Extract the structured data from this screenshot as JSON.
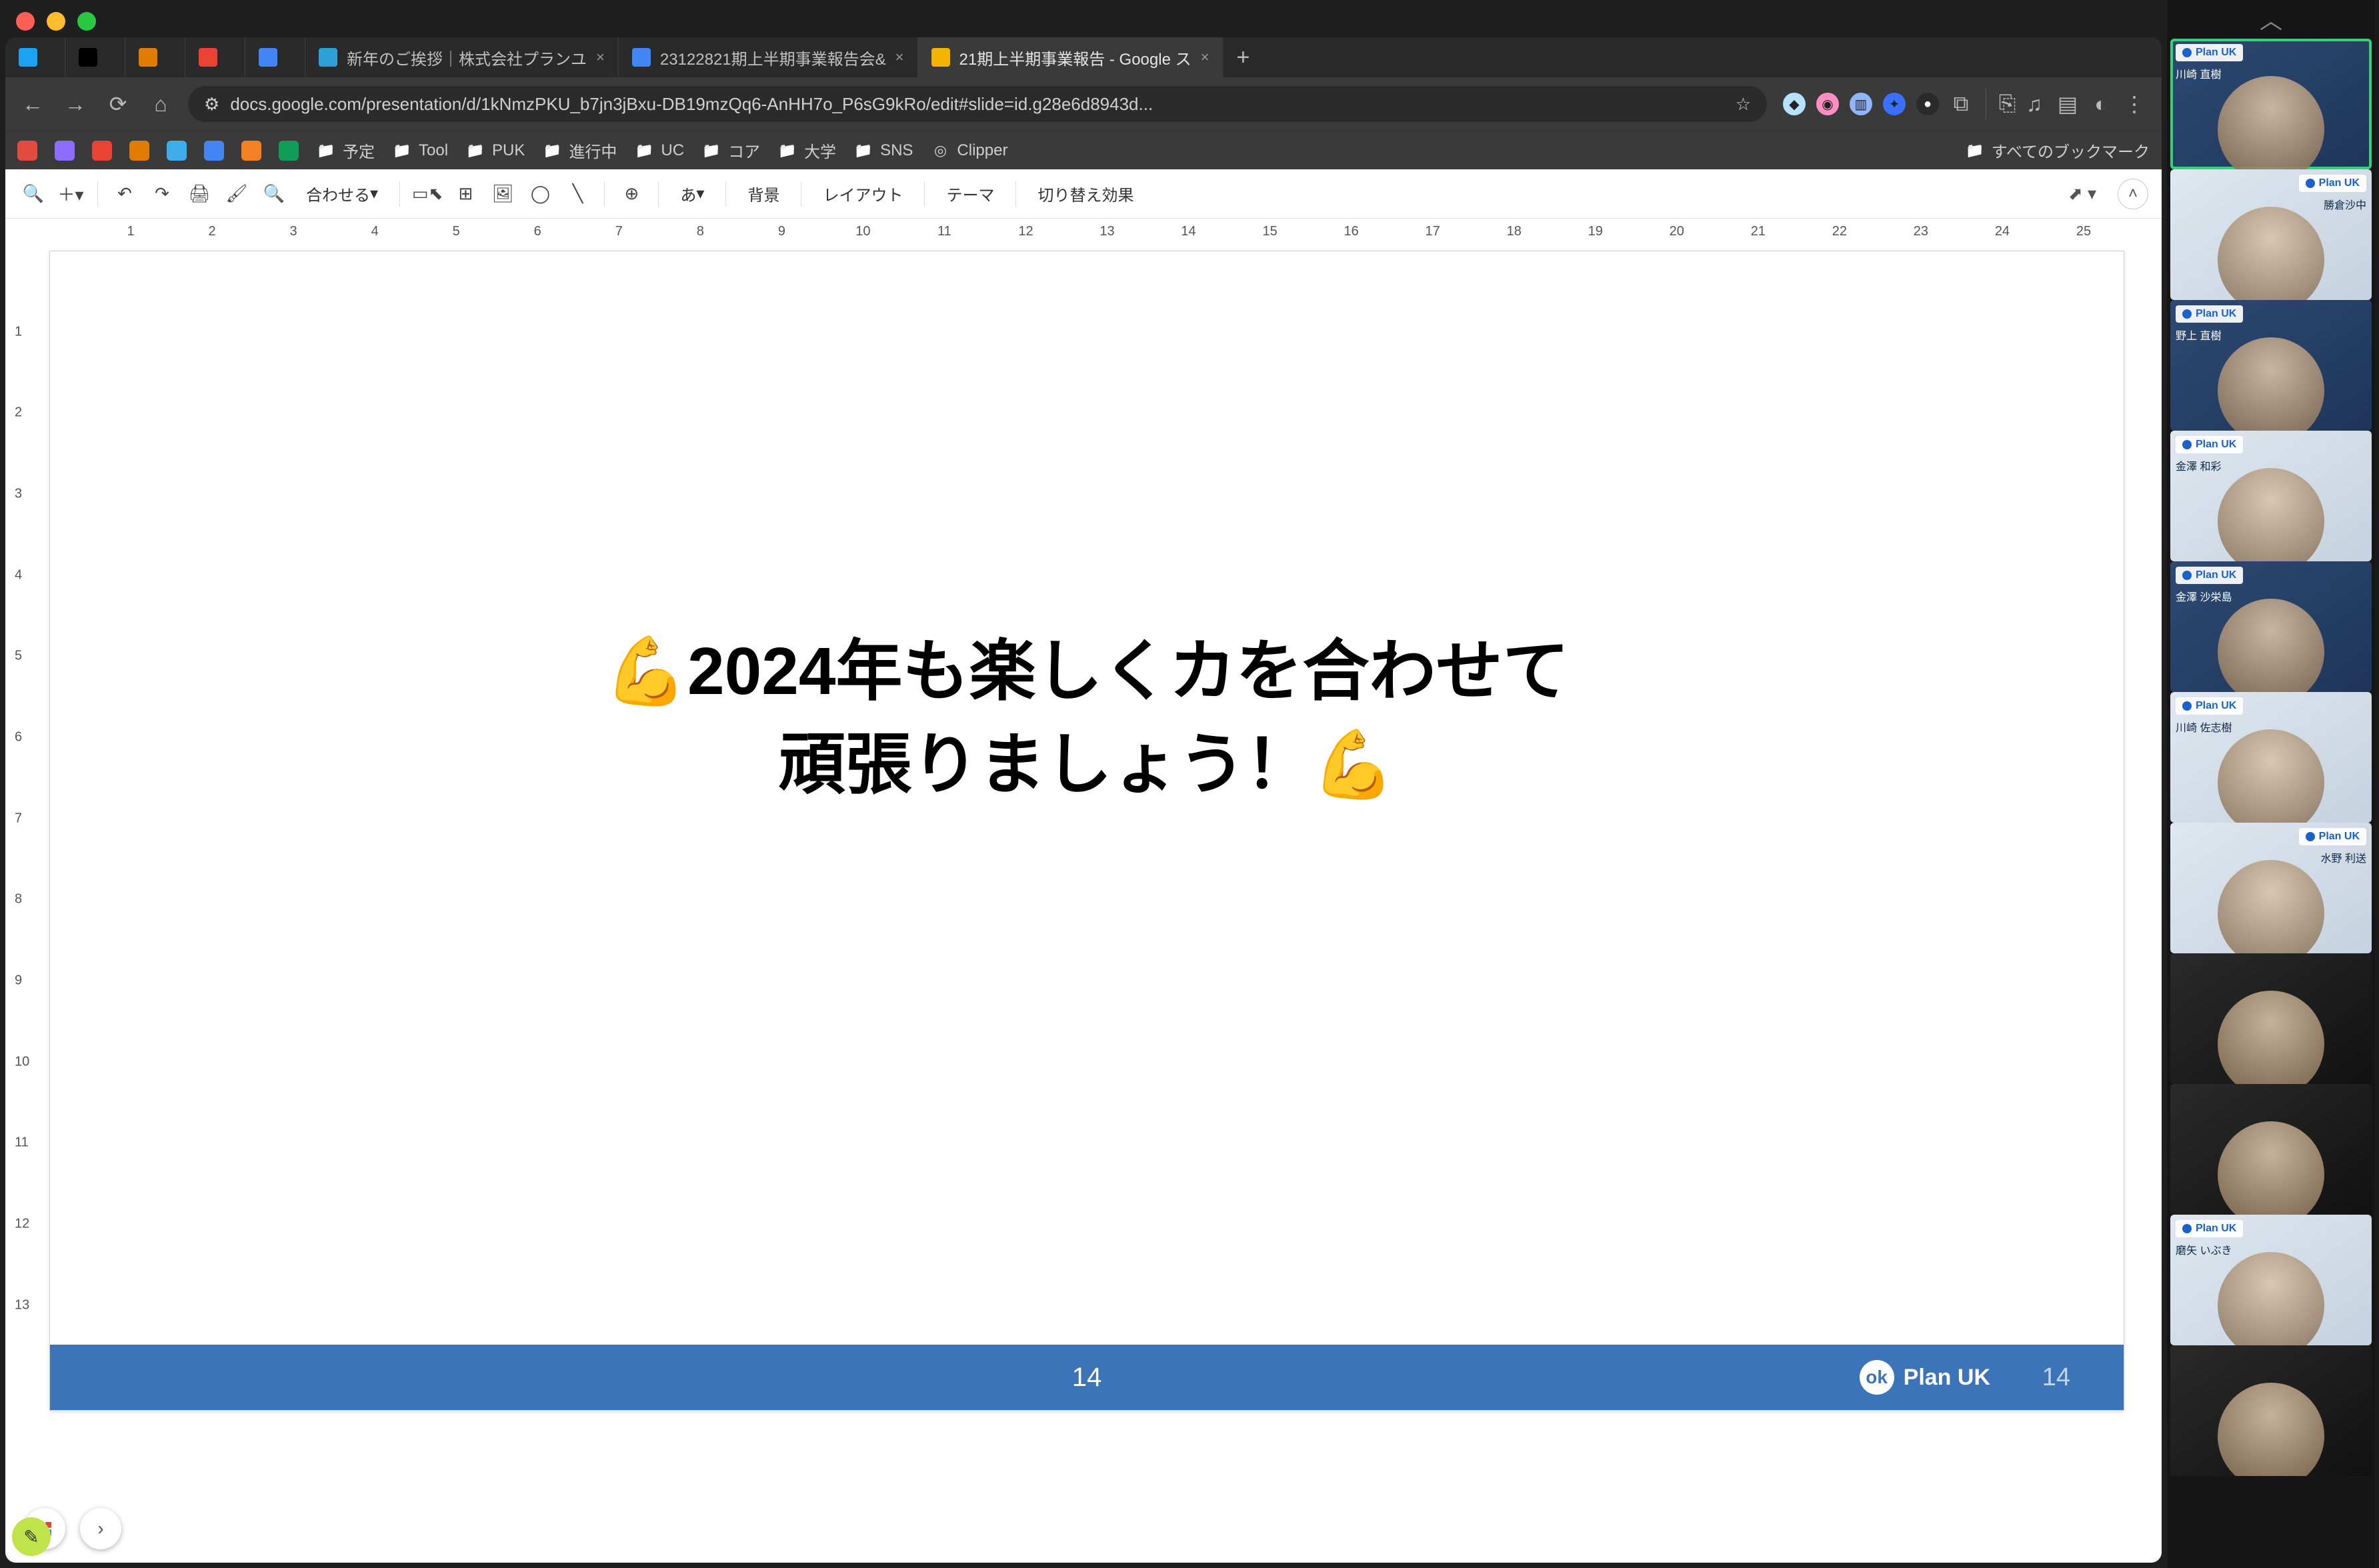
{
  "tabs": [
    {
      "icon": "",
      "label": "",
      "color": "#1da1f2"
    },
    {
      "icon": "",
      "label": "",
      "color": "#000"
    },
    {
      "icon": "",
      "label": "",
      "color": "#e07c00"
    },
    {
      "icon": "",
      "label": "",
      "color": "#ea4335"
    },
    {
      "icon": "",
      "label": "",
      "color": "#4285f4"
    },
    {
      "icon": "",
      "label": "新年のご挨拶｜株式会社プランユ",
      "color": "#2ea0d6",
      "has_close": true
    },
    {
      "icon": "",
      "label": "23122821期上半期事業報告会&",
      "color": "#4285f4",
      "has_close": true
    },
    {
      "icon": "",
      "label": "21期上半期事業報告 - Google ス",
      "color": "#f5b400",
      "has_close": true,
      "active": true
    }
  ],
  "url": "docs.google.com/presentation/d/1kNmzPKU_b7jn3jBxu-DB19mzQq6-AnHH7o_P6sG9kRo/edit#slide=id.g28e6d8943d...",
  "bookmarks": [
    {
      "type": "icon",
      "name": "logo",
      "color": "#e24c3f"
    },
    {
      "type": "icon",
      "name": "ai",
      "color": "#8b6dff"
    },
    {
      "type": "icon",
      "name": "gmail",
      "color": "#ea4335"
    },
    {
      "type": "icon",
      "name": "grid",
      "color": "#e07c00"
    },
    {
      "type": "icon",
      "name": "k",
      "color": "#3daee9"
    },
    {
      "type": "icon",
      "name": "cal",
      "color": "#4285f4"
    },
    {
      "type": "icon",
      "name": "st",
      "color": "#f48024"
    },
    {
      "type": "icon",
      "name": "drive",
      "color": "#0f9d58"
    },
    {
      "type": "folder",
      "label": "予定"
    },
    {
      "type": "folder",
      "label": "Tool"
    },
    {
      "type": "folder",
      "label": "PUK"
    },
    {
      "type": "folder",
      "label": "進行中"
    },
    {
      "type": "folder",
      "label": "UC"
    },
    {
      "type": "folder",
      "label": "コア"
    },
    {
      "type": "folder",
      "label": "大学"
    },
    {
      "type": "folder",
      "label": "SNS"
    },
    {
      "type": "clipper",
      "label": "Clipper"
    }
  ],
  "bookmarks_overflow": "すべてのブックマーク",
  "toolbar": {
    "fit": "合わせる",
    "background": "背景",
    "layout": "レイアウト",
    "theme": "テーマ",
    "transition": "切り替え効果",
    "lang": "あ"
  },
  "ruler_h": [
    1,
    2,
    3,
    4,
    5,
    6,
    7,
    8,
    9,
    10,
    11,
    12,
    13,
    14,
    15,
    16,
    17,
    18,
    19,
    20,
    21,
    22,
    23,
    24,
    25
  ],
  "ruler_v": [
    1,
    2,
    3,
    4,
    5,
    6,
    7,
    8,
    9,
    10,
    11,
    12,
    13
  ],
  "slide": {
    "line1": "💪2024年も楽しくカを合わせて",
    "line2": "頑張りましょう！💪",
    "page_number": "14",
    "page_number_right": "14",
    "brand": "Plan UK"
  },
  "participants": [
    {
      "tag": "Plan UK",
      "name": "川崎 直樹",
      "active": true,
      "style": "blue"
    },
    {
      "tag": "Plan UK",
      "name": "勝倉沙中",
      "style": "light",
      "right": true
    },
    {
      "tag": "Plan UK",
      "name": "野上 直樹",
      "style": "blue"
    },
    {
      "tag": "Plan UK",
      "name": "金澤 和彩",
      "style": "light"
    },
    {
      "tag": "Plan UK",
      "name": "金澤 沙栄島",
      "style": "blue"
    },
    {
      "tag": "Plan UK",
      "name": "川崎 佐志樹",
      "style": "light"
    },
    {
      "tag": "Plan UK",
      "name": "水野 利送",
      "style": "light",
      "right": true
    },
    {
      "tag": "",
      "name": "",
      "style": "dark"
    },
    {
      "tag": "",
      "name": "",
      "style": "dark"
    },
    {
      "tag": "Plan UK",
      "name": "磨矢 いぶき",
      "style": "light"
    },
    {
      "tag": "",
      "name": "",
      "style": "dark"
    }
  ]
}
